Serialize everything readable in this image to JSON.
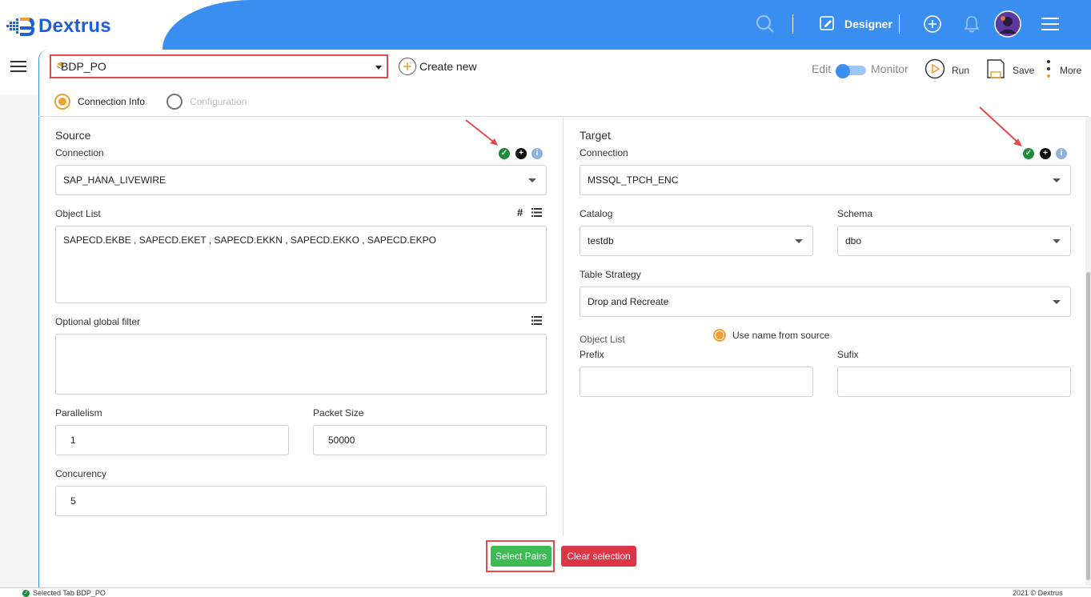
{
  "app": {
    "name": "Dextrus"
  },
  "header": {
    "designer_label": "Designer",
    "icons": [
      "search-icon",
      "designer-icon",
      "add-circle-icon",
      "bell-icon",
      "avatar",
      "menu-icon"
    ]
  },
  "toolbar": {
    "tab_name": "BDP_PO",
    "create_new": "Create new",
    "edit_label": "Edit",
    "monitor_label": "Monitor",
    "run_label": "Run",
    "save_label": "Save",
    "more_label": "More"
  },
  "steps": [
    {
      "label": "Connection Info",
      "active": true
    },
    {
      "label": "Configuration",
      "active": false
    }
  ],
  "source": {
    "title": "Source",
    "connection_label": "Connection",
    "connection_value": "SAP_HANA_LIVEWIRE",
    "object_list_label": "Object List",
    "object_list_value": "SAPECD.EKBE , SAPECD.EKET , SAPECD.EKKN , SAPECD.EKKO , SAPECD.EKPO",
    "global_filter_label": "Optional global filter",
    "global_filter_value": "",
    "parallelism_label": "Parallelism",
    "parallelism_value": "1",
    "packet_size_label": "Packet Size",
    "packet_size_value": "50000",
    "concurrency_label": "Concurency",
    "concurrency_value": "5"
  },
  "target": {
    "title": "Target",
    "connection_label": "Connection",
    "connection_value": "MSSQL_TPCH_ENC",
    "catalog_label": "Catalog",
    "catalog_value": "testdb",
    "schema_label": "Schema",
    "schema_value": "dbo",
    "table_strategy_label": "Table Strategy",
    "table_strategy_value": "Drop and Recreate",
    "object_list_label": "Object List",
    "use_name_label": "Use name from source",
    "prefix_label": "Prefix",
    "prefix_value": "",
    "suffix_label": "Sufix",
    "suffix_value": ""
  },
  "actions": {
    "select_pairs": "Select Pairs",
    "clear_selection": "Clear selection"
  },
  "footer": {
    "status": "Selected Tab BDP_PO",
    "copyright": "2021 © Dextrus"
  },
  "colors": {
    "brand_blue": "#3a8ef0",
    "logo_blue": "#1e5fd8",
    "accent_orange": "#f0a030",
    "success_green": "#3cba54",
    "danger_red": "#dc3545",
    "annotation_red": "#e24b4b"
  }
}
